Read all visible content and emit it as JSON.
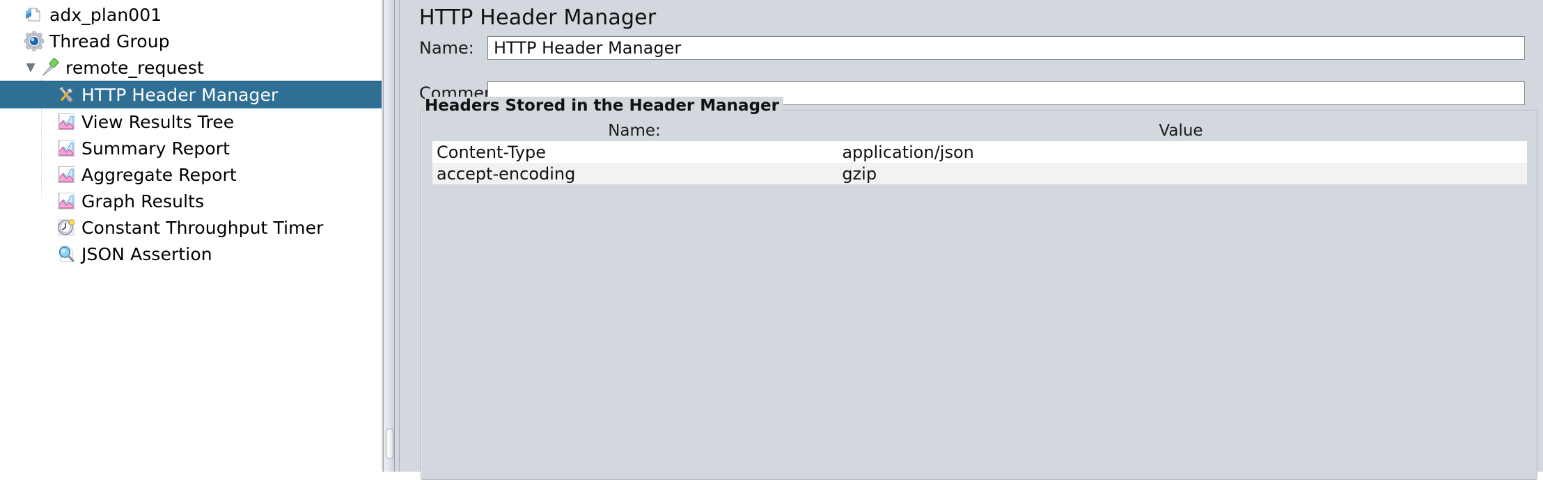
{
  "tree": {
    "items": [
      {
        "label": "adx_plan001",
        "icon": "test-plan-icon",
        "depth": 0,
        "twisty": "",
        "selected": false
      },
      {
        "label": "Thread Group",
        "icon": "thread-group-icon",
        "depth": 0,
        "twisty": "",
        "selected": false
      },
      {
        "label": "remote_request",
        "icon": "http-request-icon",
        "depth": 1,
        "twisty": "▼",
        "selected": false
      },
      {
        "label": "HTTP Header Manager",
        "icon": "header-manager-icon",
        "depth": 2,
        "twisty": "",
        "selected": true
      },
      {
        "label": "View Results Tree",
        "icon": "listener-graph-icon",
        "depth": 2,
        "twisty": "",
        "selected": false
      },
      {
        "label": "Summary Report",
        "icon": "listener-graph-icon",
        "depth": 2,
        "twisty": "",
        "selected": false
      },
      {
        "label": "Aggregate Report",
        "icon": "listener-graph-icon",
        "depth": 2,
        "twisty": "",
        "selected": false
      },
      {
        "label": "Graph Results",
        "icon": "listener-graph-icon",
        "depth": 2,
        "twisty": "",
        "selected": false
      },
      {
        "label": "Constant Throughput Timer",
        "icon": "timer-clock-icon",
        "depth": 2,
        "twisty": "",
        "selected": false
      },
      {
        "label": "JSON Assertion",
        "icon": "assertion-magnifier-icon",
        "depth": 2,
        "twisty": "",
        "selected": false
      }
    ]
  },
  "panel": {
    "title": "HTTP Header Manager",
    "name_label": "Name:",
    "name_value": "HTTP Header Manager",
    "name_placeholder": "",
    "comments_label": "Comments:",
    "comments_value": "",
    "comments_placeholder": "",
    "group_title": "Headers Stored in the Header Manager"
  },
  "table": {
    "columns": [
      "Name:",
      "Value"
    ],
    "rows": [
      {
        "name": "Content-Type",
        "value": "application/json"
      },
      {
        "name": "accept-encoding",
        "value": "gzip"
      }
    ]
  },
  "colors": {
    "selection": "#2f6f94",
    "panel_bg": "#d3d7de",
    "tree_bg": "#ffffff",
    "row_odd": "#ffffff",
    "row_even": "#f2f2f2"
  }
}
